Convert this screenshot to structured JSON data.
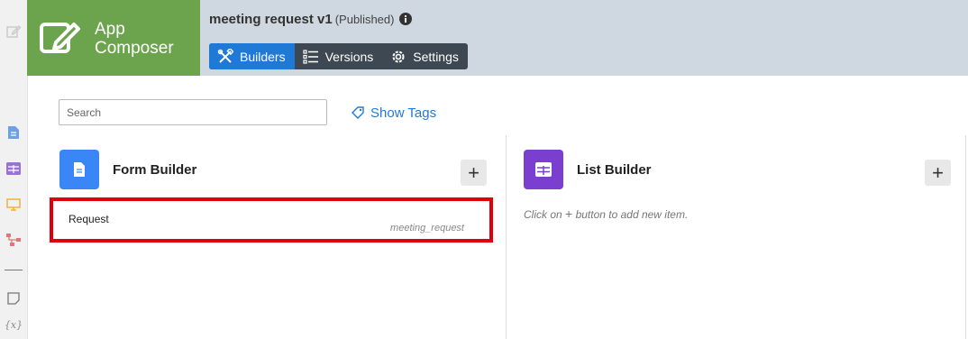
{
  "app": {
    "logo_line1": "App",
    "logo_line2": "Composer"
  },
  "header": {
    "title": "meeting request v1",
    "status": "(Published)"
  },
  "tabs": [
    {
      "label": "Builders",
      "icon": "tools-icon",
      "active": true
    },
    {
      "label": "Versions",
      "icon": "list-icon",
      "active": false
    },
    {
      "label": "Settings",
      "icon": "gear-icon",
      "active": false
    }
  ],
  "search": {
    "placeholder": "Search",
    "value": ""
  },
  "show_tags": {
    "label": "Show Tags"
  },
  "form_builder": {
    "title": "Form Builder",
    "add_label": "+",
    "items": [
      {
        "name": "Request",
        "tag": "meeting_request"
      }
    ]
  },
  "list_builder": {
    "title": "List Builder",
    "add_label": "+",
    "hint_prefix": "Click on",
    "hint_symbol": "+",
    "hint_suffix": "button to add new item."
  },
  "sidebar": {
    "icons": [
      "edit-icon",
      "document-icon",
      "table-icon",
      "monitor-icon",
      "workflow-icon",
      "note-icon",
      "variable-icon"
    ],
    "variable_label": "{x}"
  },
  "colors": {
    "accent": "#1f79d6",
    "logo_bg": "#6ca44d",
    "form_icon_bg": "#3b86f7",
    "list_icon_bg": "#7a3fcf",
    "highlight": "#e0000b"
  }
}
